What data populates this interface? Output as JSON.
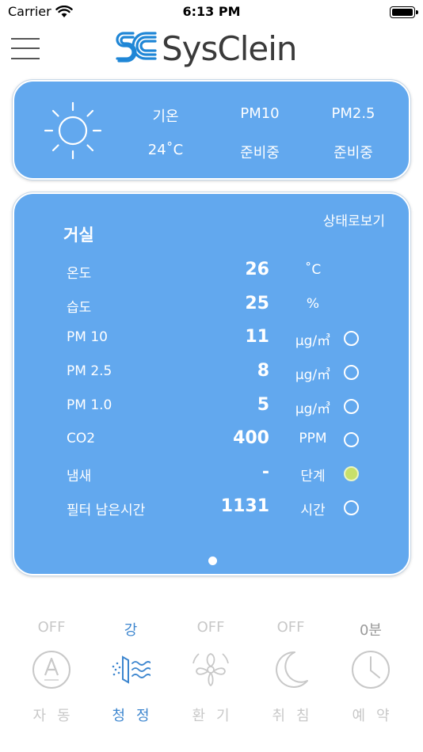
{
  "status_bar": {
    "carrier": "Carrier",
    "time": "6:13 PM"
  },
  "app": {
    "logo_text": "SysClein",
    "logo_mark": "SC"
  },
  "weather": {
    "icon": "sun-icon",
    "columns": [
      {
        "label": "기온",
        "value": "24˚C"
      },
      {
        "label": "PM10",
        "value": "준비중"
      },
      {
        "label": "PM2.5",
        "value": "준비중"
      }
    ]
  },
  "room": {
    "status_link": "상태로보기",
    "title": "거실",
    "rows": [
      {
        "label": "온도",
        "value": "26",
        "unit": "˚C",
        "indicator": "none"
      },
      {
        "label": "습도",
        "value": "25",
        "unit": "%",
        "indicator": "none"
      },
      {
        "label": "PM 10",
        "value": "11",
        "unit": "μg/㎥",
        "indicator": "blue"
      },
      {
        "label": "PM 2.5",
        "value": "8",
        "unit": "μg/㎥",
        "indicator": "blue"
      },
      {
        "label": "PM 1.0",
        "value": "5",
        "unit": "μg/㎥",
        "indicator": "blue"
      },
      {
        "label": "CO2",
        "value": "400",
        "unit": "PPM",
        "indicator": "blue"
      },
      {
        "label": "냄새",
        "value": "-",
        "unit": "단계",
        "indicator": "green"
      },
      {
        "label": "필터 남은시간",
        "value": "1131",
        "unit": "시간",
        "indicator": "blue"
      }
    ],
    "page_count": 1
  },
  "controls": [
    {
      "state": "OFF",
      "name": "자동",
      "icon": "auto-mode-icon",
      "active": false
    },
    {
      "state": "강",
      "name": "청정",
      "icon": "purify-icon",
      "active": true
    },
    {
      "state": "OFF",
      "name": "환기",
      "icon": "fan-icon",
      "active": false
    },
    {
      "state": "OFF",
      "name": "취침",
      "icon": "moon-icon",
      "active": false
    },
    {
      "state": "0분",
      "name": "예약",
      "icon": "clock-icon",
      "active": false
    }
  ],
  "colors": {
    "card": "#62a8ee",
    "accent": "#3d86cf",
    "inactive": "#c8c8c8",
    "odor_indicator": "#c8e06a"
  }
}
